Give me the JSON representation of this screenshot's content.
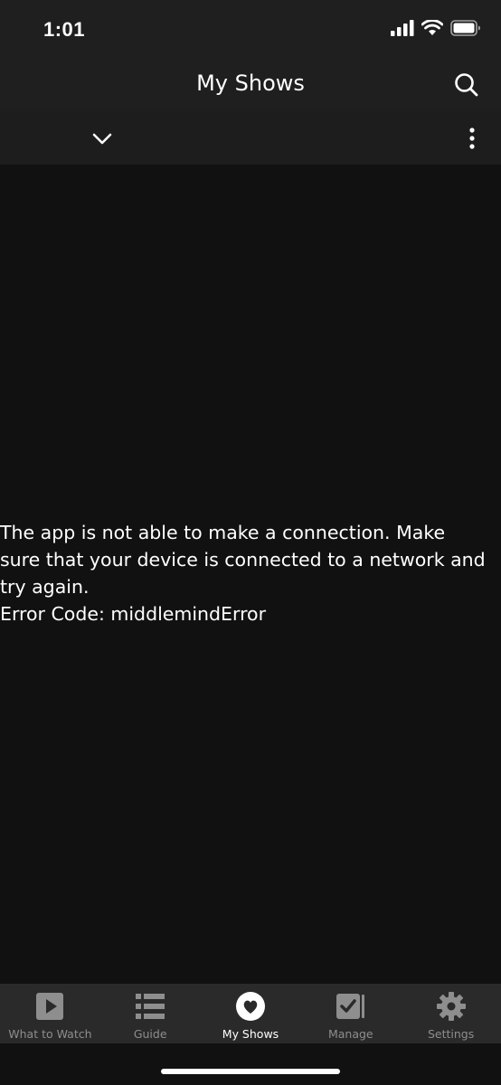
{
  "status_bar": {
    "time": "1:01"
  },
  "header": {
    "title": "My Shows"
  },
  "error": {
    "message": "The app is not able to make a connection. Make sure that your device is connected to a network and try again.",
    "code_line": "Error Code: middlemindError"
  },
  "tabs": [
    {
      "label": "What to Watch",
      "icon": "play-icon",
      "active": false
    },
    {
      "label": "Guide",
      "icon": "list-icon",
      "active": false
    },
    {
      "label": "My Shows",
      "icon": "heart-icon",
      "active": true
    },
    {
      "label": "Manage",
      "icon": "checkbox-icon",
      "active": false
    },
    {
      "label": "Settings",
      "icon": "gear-icon",
      "active": false
    }
  ],
  "colors": {
    "background": "#111111",
    "bar": "#1f1f1f",
    "tab_bar": "#2a2a2a",
    "inactive": "#8e8e8e",
    "active": "#ffffff"
  }
}
